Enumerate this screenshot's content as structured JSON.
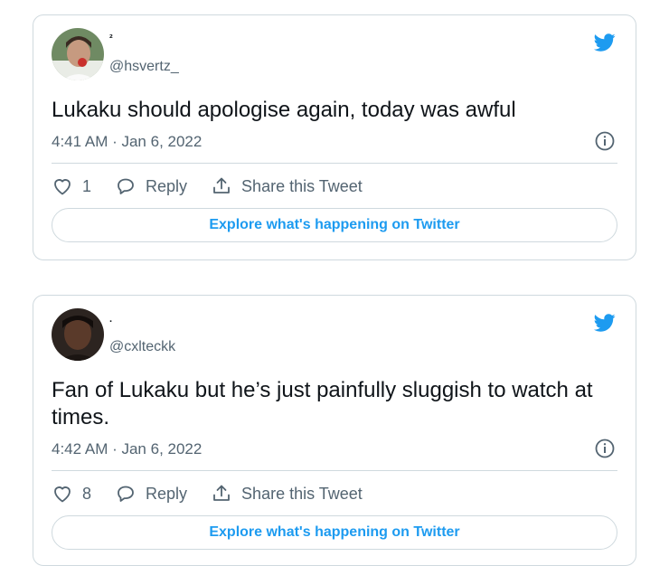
{
  "tweets": [
    {
      "display_name": "²",
      "handle": "@hsvertz_",
      "text": "Lukaku should apologise again, today was awful",
      "timestamp": "4:41 AM · Jan 6, 2022",
      "likes": "1",
      "reply_label": "Reply",
      "share_label": "Share this Tweet",
      "explore_label": "Explore what's happening on Twitter"
    },
    {
      "display_name": ".",
      "handle": "@cxlteckk",
      "text": "Fan of Lukaku but he’s just painfully sluggish to watch at times.",
      "timestamp": "4:42 AM · Jan 6, 2022",
      "likes": "8",
      "reply_label": "Reply",
      "share_label": "Share this Tweet",
      "explore_label": "Explore what's happening on Twitter"
    }
  ],
  "icons": {
    "brand": "twitter-bird-icon",
    "info": "info-icon",
    "like": "heart-icon",
    "reply": "reply-bubble-icon",
    "share": "share-upload-icon"
  },
  "colors": {
    "brand_blue": "#1d9bf0",
    "secondary_text": "#536471",
    "border": "#cfd9de"
  }
}
